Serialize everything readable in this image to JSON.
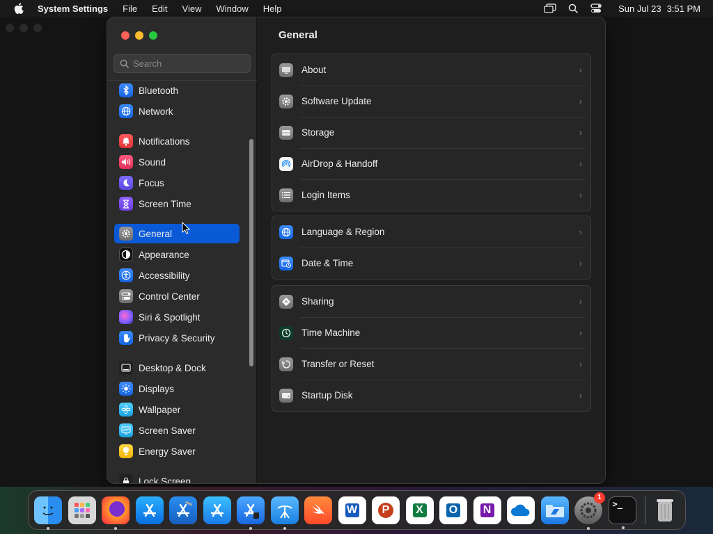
{
  "menubar": {
    "app_name": "System Settings",
    "menus": [
      "File",
      "Edit",
      "View",
      "Window",
      "Help"
    ],
    "clock_date": "Sun Jul 23",
    "clock_time": "3:51 PM"
  },
  "window": {
    "search_placeholder": "Search",
    "main_title": "General"
  },
  "sidebar": {
    "items": [
      {
        "label": "Bluetooth",
        "icon": "bluetooth-icon"
      },
      {
        "label": "Network",
        "icon": "globe-icon"
      },
      {
        "label": "Notifications",
        "icon": "bell-icon"
      },
      {
        "label": "Sound",
        "icon": "speaker-icon"
      },
      {
        "label": "Focus",
        "icon": "moon-icon"
      },
      {
        "label": "Screen Time",
        "icon": "hourglass-icon"
      },
      {
        "label": "General",
        "icon": "gear-icon",
        "active": true
      },
      {
        "label": "Appearance",
        "icon": "appearance-icon"
      },
      {
        "label": "Accessibility",
        "icon": "accessibility-icon"
      },
      {
        "label": "Control Center",
        "icon": "toggles-icon"
      },
      {
        "label": "Siri & Spotlight",
        "icon": "siri-icon"
      },
      {
        "label": "Privacy & Security",
        "icon": "hand-icon"
      },
      {
        "label": "Desktop & Dock",
        "icon": "dock-icon"
      },
      {
        "label": "Displays",
        "icon": "sun-icon"
      },
      {
        "label": "Wallpaper",
        "icon": "flower-icon"
      },
      {
        "label": "Screen Saver",
        "icon": "screensaver-icon"
      },
      {
        "label": "Energy Saver",
        "icon": "bulb-icon"
      },
      {
        "label": "Lock Screen",
        "icon": "lock-icon"
      }
    ]
  },
  "groups": [
    {
      "rows": [
        {
          "label": "About",
          "icon": "monitor-icon"
        },
        {
          "label": "Software Update",
          "icon": "gear-badge-icon"
        },
        {
          "label": "Storage",
          "icon": "drive-icon"
        },
        {
          "label": "AirDrop & Handoff",
          "icon": "airdrop-icon"
        },
        {
          "label": "Login Items",
          "icon": "list-icon"
        }
      ]
    },
    {
      "rows": [
        {
          "label": "Language & Region",
          "icon": "globe-icon"
        },
        {
          "label": "Date & Time",
          "icon": "calendar-clock-icon"
        }
      ]
    },
    {
      "rows": [
        {
          "label": "Sharing",
          "icon": "sharing-icon"
        },
        {
          "label": "Time Machine",
          "icon": "time-machine-icon"
        },
        {
          "label": "Transfer or Reset",
          "icon": "reset-icon"
        },
        {
          "label": "Startup Disk",
          "icon": "disk-icon"
        }
      ]
    }
  ],
  "dock": {
    "apps": [
      "Finder",
      "Launchpad",
      "Firefox",
      "App Store",
      "Xcode",
      "App Store",
      "Simulator",
      "Instruments",
      "Swift Playgrounds",
      "Word",
      "PowerPoint",
      "Excel",
      "Outlook",
      "OneNote",
      "OneDrive",
      "Files",
      "System Settings",
      "Terminal"
    ],
    "settings_badge": "1",
    "trash": "Trash",
    "letters": {
      "word": "W",
      "powerpoint": "P",
      "excel": "X",
      "outlook": "O",
      "onenote": "N"
    }
  }
}
